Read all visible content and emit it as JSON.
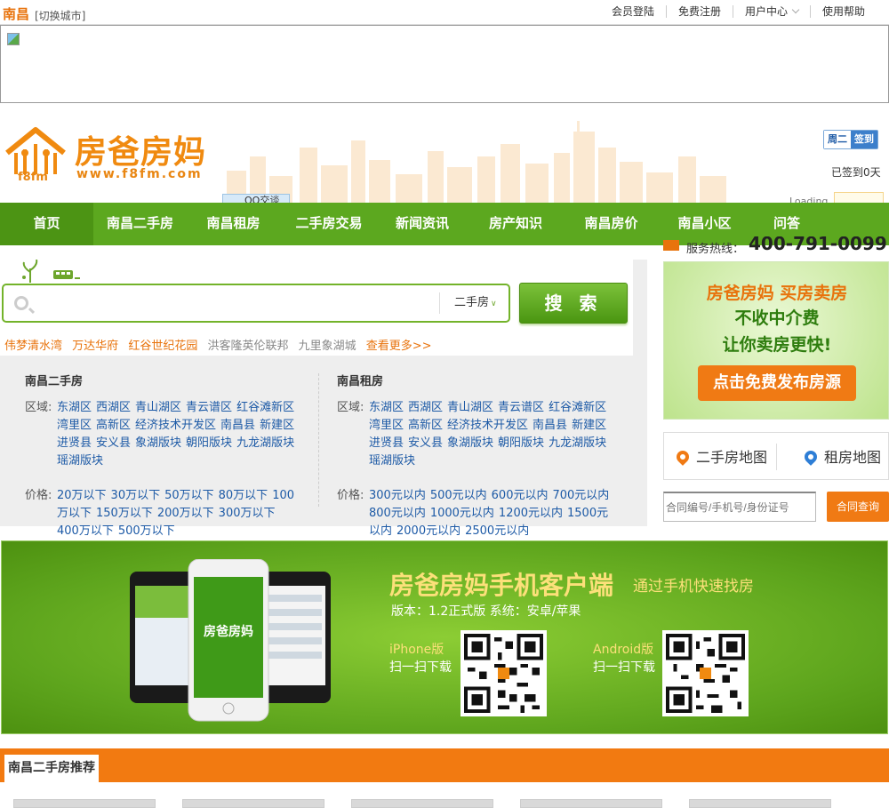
{
  "topbar": {
    "city": "南昌",
    "switch_city": "[切换城市]",
    "links": [
      "会员登陆",
      "免费注册",
      "用户中心",
      "使用帮助"
    ]
  },
  "header": {
    "logo_title": "房爸房妈",
    "logo_url": "www.f8fm.com",
    "logo_abbr": "f8fm",
    "qq_tag": "QQ交谈",
    "calendar_day": "周二",
    "calendar_sign": "签到",
    "signed_days": "已签到0天",
    "loading": "Loading"
  },
  "nav": {
    "items": [
      "首页",
      "南昌二手房",
      "南昌租房",
      "二手房交易",
      "新闻资讯",
      "房产知识",
      "南昌房价",
      "南昌小区",
      "问答"
    ]
  },
  "search": {
    "placeholder": "",
    "type": "二手房",
    "button": "搜 索",
    "hot_orange": [
      "伟梦清水湾",
      "万达华府",
      "红谷世纪花园"
    ],
    "hot_gray": [
      "洪客隆英伦联邦",
      "九里象湖城"
    ],
    "more": "查看更多>>"
  },
  "categories": {
    "sale": {
      "title": "南昌二手房",
      "area_label": "区域:",
      "areas": [
        "东湖区",
        "西湖区",
        "青山湖区",
        "青云谱区",
        "红谷滩新区",
        "湾里区",
        "高新区",
        "经济技术开发区",
        "南昌县",
        "新建区",
        "进贤县",
        "安义县",
        "象湖版块",
        "朝阳版块",
        "九龙湖版块",
        "瑶湖版块"
      ],
      "price_label": "价格:",
      "prices": [
        "20万以下",
        "30万以下",
        "50万以下",
        "80万以下",
        "100万以下",
        "150万以下",
        "200万以下",
        "300万以下",
        "400万以下",
        "500万以下"
      ]
    },
    "rent": {
      "title": "南昌租房",
      "area_label": "区域:",
      "areas": [
        "东湖区",
        "西湖区",
        "青山湖区",
        "青云谱区",
        "红谷滩新区",
        "湾里区",
        "高新区",
        "经济技术开发区",
        "南昌县",
        "新建区",
        "进贤县",
        "安义县",
        "象湖版块",
        "朝阳版块",
        "九龙湖版块",
        "瑶湖版块"
      ],
      "price_label": "价格:",
      "prices": [
        "300元以内",
        "500元以内",
        "600元以内",
        "700元以内",
        "800元以内",
        "1000元以内",
        "1200元以内",
        "1500元以内",
        "2000元以内",
        "2500元以内"
      ]
    }
  },
  "sidebar": {
    "hotline_label": "服务热线：",
    "hotline_number": "400-791-0099",
    "promo_line1": "房爸房妈  买房卖房",
    "promo_line2": "不收中介费",
    "promo_line3": "让你卖房更快!",
    "promo_button": "点击免费发布房源",
    "map_sale": "二手房地图",
    "map_rent": "租房地图",
    "contract_placeholder": "合同编号/手机号/身份证号",
    "contract_button": "合同查询"
  },
  "app_banner": {
    "title": "房爸房妈手机客户端",
    "subtitle": "通过手机快速找房",
    "version": "版本：1.2正式版    系统：安卓/苹果",
    "iphone_label": "iPhone版",
    "android_label": "Android版",
    "scan_label": "扫一扫下载",
    "phone_brand": "房爸房妈"
  },
  "section": {
    "title": "南昌二手房推荐"
  },
  "colors": {
    "brand_orange": "#f27a11",
    "nav_green": "#5ca81f",
    "link_blue": "#1d5aa6"
  }
}
